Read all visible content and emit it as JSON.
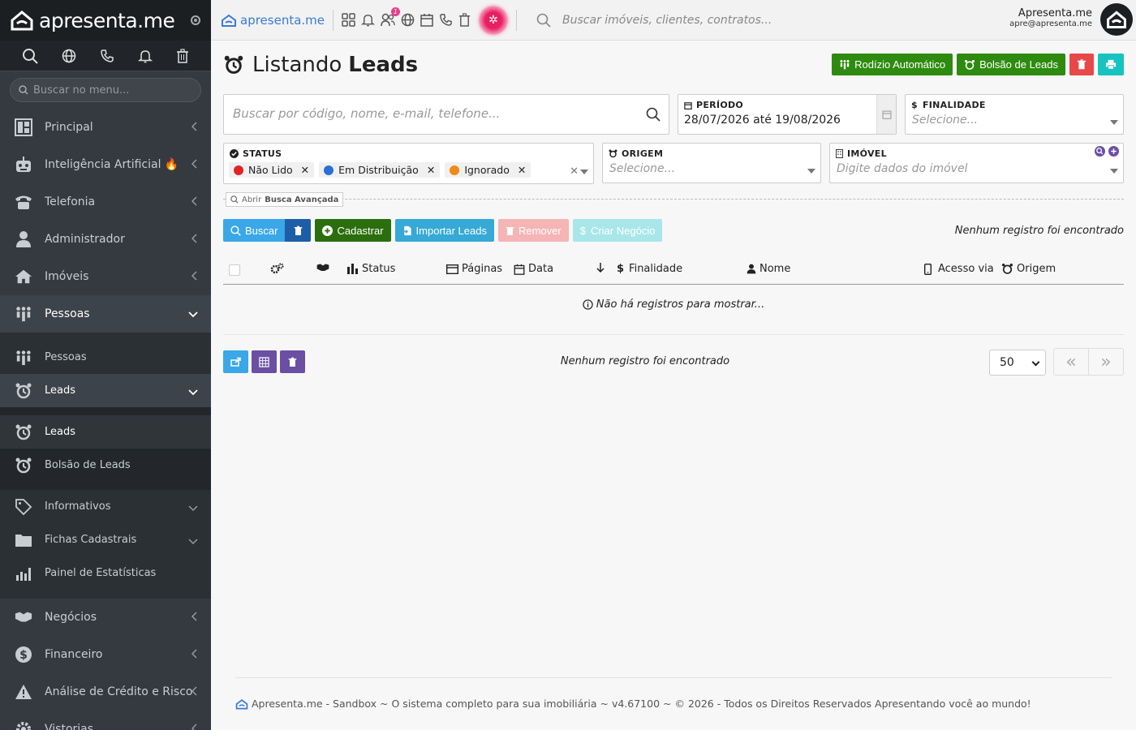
{
  "brand": {
    "name": "apresenta.me"
  },
  "sidebar": {
    "search_placeholder": "Buscar no menu...",
    "items": [
      {
        "label": "Principal"
      },
      {
        "label": "Inteligência Artificial 🔥"
      },
      {
        "label": "Telefonia"
      },
      {
        "label": "Administrador"
      },
      {
        "label": "Imóveis"
      },
      {
        "label": "Pessoas"
      }
    ],
    "pessoas_sub": [
      {
        "label": "Pessoas"
      },
      {
        "label": "Leads"
      }
    ],
    "leads_sub": [
      {
        "label": "Leads"
      },
      {
        "label": "Bolsão de Leads"
      }
    ],
    "more_sub": [
      {
        "label": "Informativos"
      },
      {
        "label": "Fichas Cadastrais"
      },
      {
        "label": "Painel de Estatísticas"
      }
    ],
    "bottom": [
      {
        "label": "Negócios"
      },
      {
        "label": "Financeiro"
      },
      {
        "label": "Análise de Crédito e Risco"
      },
      {
        "label": "Vistorias"
      }
    ]
  },
  "topbar": {
    "logo": "apresenta.me",
    "badge": "1",
    "search_placeholder": "Buscar imóveis, clientes, contratos...",
    "user_name": "Apresenta.me",
    "user_email": "apre@apresenta.me"
  },
  "page": {
    "title_prefix": "Listando",
    "title_bold": "Leads",
    "btn_rodizio": "Rodízio Automático",
    "btn_bolsao": "Bolsão de Leads"
  },
  "filters": {
    "search_placeholder": "Buscar por código, nome, e-mail, telefone...",
    "periodo_label": "PERÍODO",
    "periodo_value": "28/07/2026 até 19/08/2026",
    "finalidade_label": "FINALIDADE",
    "finalidade_placeholder": "Selecione...",
    "status_label": "STATUS",
    "status_tags": [
      {
        "label": "Não Lido",
        "color": "#e02424"
      },
      {
        "label": "Em Distribuição",
        "color": "#2b6fd6"
      },
      {
        "label": "Ignorado",
        "color": "#f08a16"
      }
    ],
    "origem_label": "ORIGEM",
    "origem_placeholder": "Selecione...",
    "imovel_label": "IMÓVEL",
    "imovel_placeholder": "Digite dados do imóvel",
    "advanced_prefix": "Abrir",
    "advanced_bold": "Busca Avançada"
  },
  "actions": {
    "buscar": "Buscar",
    "cadastrar": "Cadastrar",
    "importar": "Importar Leads",
    "remover": "Remover",
    "criar": "Criar Negócio",
    "empty": "Nenhum registro foi encontrado"
  },
  "table": {
    "columns": [
      "Status",
      "Páginas",
      "Data",
      "Finalidade",
      "Nome",
      "Acesso via",
      "Origem"
    ],
    "empty": "Não há registros para mostrar..."
  },
  "pager": {
    "empty": "Nenhum registro foi encontrado",
    "per_page": "50",
    "first": "«",
    "last": "»"
  },
  "footer": {
    "text": "Apresenta.me - Sandbox ~ O sistema completo para sua imobiliária ~ v4.67100 ~ © 2026 - Todos os Direitos Reservados Apresentando você ao mundo!"
  }
}
